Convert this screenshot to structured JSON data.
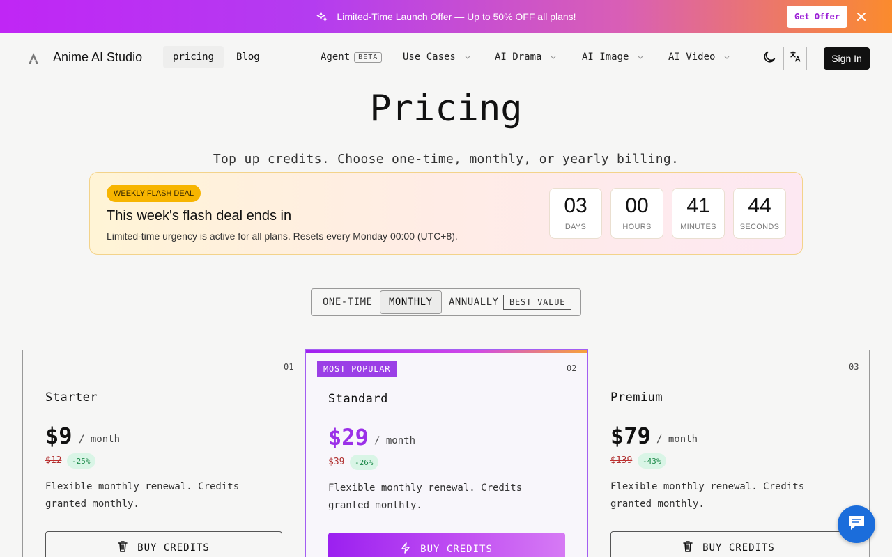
{
  "banner": {
    "text": "Limited-Time Launch Offer — Up to 50% OFF all plans!",
    "cta": "Get Offer"
  },
  "nav": {
    "brand": "Anime AI Studio",
    "links": [
      "pricing",
      "Blog"
    ],
    "agent": "Agent",
    "agent_badge": "BETA",
    "menus": [
      "Use Cases",
      "AI Drama",
      "AI Image",
      "AI Video"
    ],
    "sign_in": "Sign In"
  },
  "hero": {
    "title": "Pricing",
    "subtitle": "Top up credits. Choose one-time, monthly, or yearly billing."
  },
  "flash": {
    "badge": "WEEKLY FLASH DEAL",
    "title": "This week's flash deal ends in",
    "desc": "Limited-time urgency is active for all plans. Resets every Monday 00:00 (UTC+8).",
    "countdown": [
      {
        "value": "03",
        "label": "DAYS"
      },
      {
        "value": "00",
        "label": "HOURS"
      },
      {
        "value": "41",
        "label": "MINUTES"
      },
      {
        "value": "44",
        "label": "SECONDS"
      }
    ]
  },
  "billing": {
    "options": [
      "ONE-TIME",
      "MONTHLY",
      "ANNUALLY"
    ],
    "selected": "MONTHLY",
    "best_value": "BEST VALUE"
  },
  "plans": [
    {
      "num": "01",
      "name": "Starter",
      "price": "$9",
      "per": "/ month",
      "old": "$12",
      "discount": "-25%",
      "desc": "Flexible monthly renewal. Credits granted monthly.",
      "cta": "BUY CREDITS"
    },
    {
      "num": "02",
      "badge": "MOST POPULAR",
      "name": "Standard",
      "price": "$29",
      "per": "/ month",
      "old": "$39",
      "discount": "-26%",
      "desc": "Flexible monthly renewal. Credits granted monthly.",
      "cta": "BUY CREDITS"
    },
    {
      "num": "03",
      "name": "Premium",
      "price": "$79",
      "per": "/ month",
      "old": "$139",
      "discount": "-43%",
      "desc": "Flexible monthly renewal. Credits granted monthly.",
      "cta": "BUY CREDITS"
    }
  ],
  "colors": {
    "accent_purple": "#9b30e8",
    "banner_start": "#c026f5",
    "banner_end": "#fb8b2d",
    "flash_badge": "#f7b500",
    "discount_green": "#1d8a4a",
    "chat_blue": "#1b6ddb"
  },
  "icons": [
    "sparkle-icon",
    "close-icon",
    "logo-icon",
    "chevron-down-icon",
    "moon-icon",
    "translate-icon",
    "trash-icon",
    "bolt-icon",
    "chat-icon"
  ]
}
